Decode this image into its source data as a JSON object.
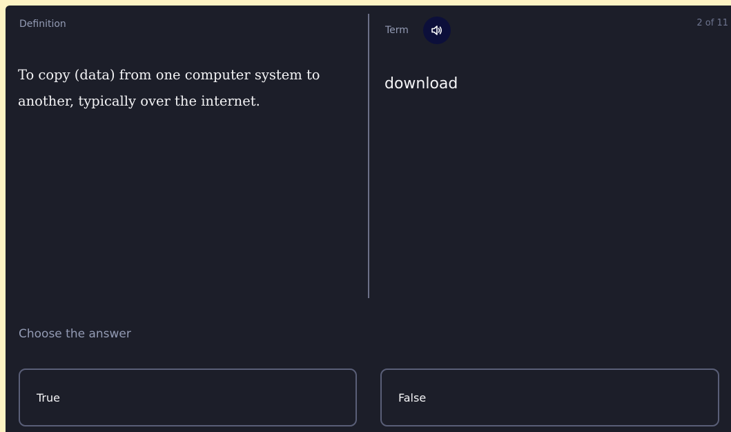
{
  "card": {
    "definition_label": "Definition",
    "definition_text": "To copy (data) from one computer system to another, typically over the internet.",
    "term_label": "Term",
    "term_text": "download",
    "progress": "2 of 11",
    "audio_icon": "speaker-icon"
  },
  "answer": {
    "prompt": "Choose the answer",
    "options": [
      {
        "label": "True"
      },
      {
        "label": "False"
      }
    ]
  },
  "colors": {
    "page_background": "#fdf3c4",
    "card_background": "#1c1e29",
    "audio_button": "#0c0f3a",
    "muted_text": "#939bb4",
    "primary_text": "#f4f4f6",
    "option_border": "#5a5f78"
  }
}
